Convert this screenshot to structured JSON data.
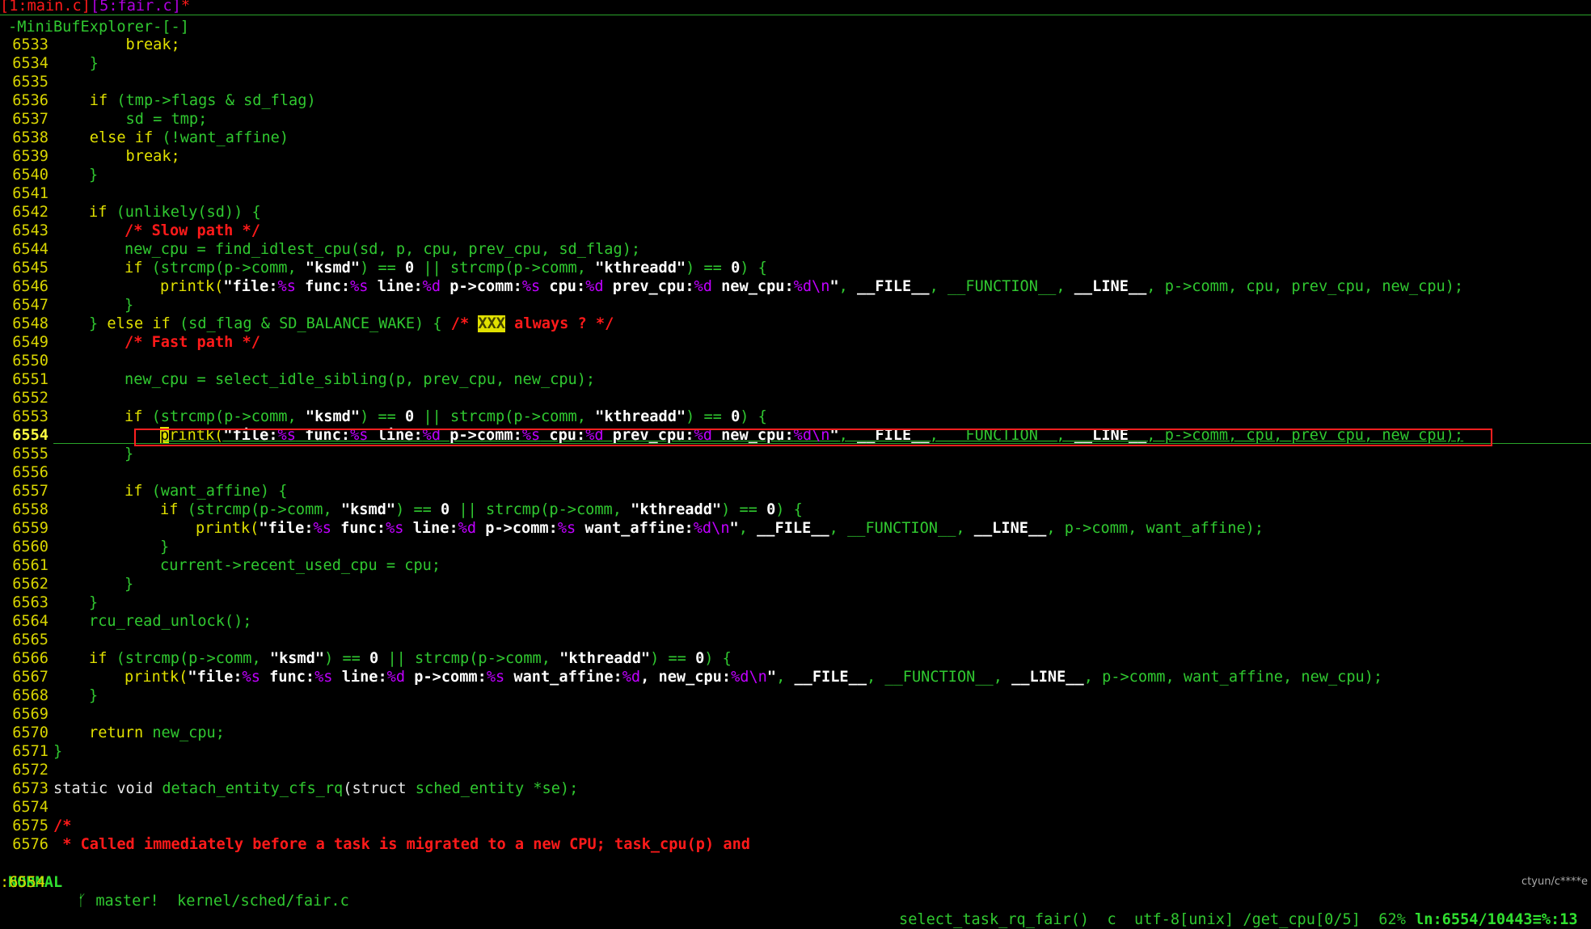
{
  "tabline": {
    "tab1": "[1:main.c]",
    "tab2": "[5:fair.c]",
    "modified": "*"
  },
  "minibuf": "-MiniBufExplorer-[-]",
  "gutter": [
    "6533",
    "6534",
    "6535",
    "6536",
    "6537",
    "6538",
    "6539",
    "6540",
    "6541",
    "6542",
    "6543",
    "6544",
    "6545",
    "6546",
    "6547",
    "6548",
    "6549",
    "6550",
    "6551",
    "6552",
    "6553",
    "6554",
    "6555",
    "6556",
    "6557",
    "6558",
    "6559",
    "6560",
    "6561",
    "6562",
    "6563",
    "6564",
    "6565",
    "6566",
    "6567",
    "6568",
    "6569",
    "6570",
    "6571",
    "6572",
    "6573",
    "6574",
    "6575",
    "6576"
  ],
  "code": {
    "l6533": "        break;",
    "l6534": "    }",
    "l6536a": "    ",
    "l6536b": "if",
    "l6536c": " (tmp->flags & sd_flag)",
    "l6537": "        sd = tmp;",
    "l6538a": "    ",
    "l6538b": "else if",
    "l6538c": " (!want_affine)",
    "l6539": "        break;",
    "l6540": "}",
    "l6542a": "if",
    "l6542b": " (unlikely(sd)) {",
    "l6543": "/* Slow path */",
    "l6544": "new_cpu = find_idlest_cpu(sd, p, cpu, prev_cpu, sd_flag);",
    "strcmp_if": "if",
    "strcmp_1": " (strcmp(p->comm, ",
    "ksmd": "\"ksmd\"",
    "strcmp_2": ") == ",
    "zero": "0",
    "strcmp_3": " || strcmp(p->comm, ",
    "kthreadd": "\"kthreadd\"",
    "strcmp_4": ") == ",
    "strcmp_5": ") {",
    "printk": "printk(",
    "pk_file": "\"file:",
    "fmt_s": "%s",
    "pk_func": " func:",
    "pk_line": " line:",
    "fmt_d": "%d",
    "pk_comm": " p->comm:",
    "pk_cpu": " cpu:",
    "pk_prev": " prev_cpu:",
    "pk_new": " new_cpu:",
    "fmt_dn": "%d\\n",
    "quote": "\"",
    "comma": ", ",
    "FILE": "__FILE__",
    "FUNCTION": "__FUNCTION__",
    "LINE": "__LINE__",
    "args1": "p->comm, cpu, prev_cpu, new_cpu);",
    "close": "}",
    "l6548a": "} ",
    "l6548b": "else if",
    "l6548c": " (sd_flag & SD_BALANCE_WAKE) { ",
    "l6548d": "/* ",
    "xxx": "XXX",
    "l6548e": " always ? */",
    "l6549": "/* Fast path */",
    "l6551": "new_cpu = select_idle_sibling(p, prev_cpu, new_cpu);",
    "l6554_p": "p",
    "l6554_rest": "rintk(",
    "l6557a": "if",
    "l6557b": " (want_affine) {",
    "pk_wa": " want_affine:",
    "args2": "p->comm, want_affine);",
    "l6561": "current->recent_used_cpu = cpu;",
    "l6564": "rcu_read_unlock();",
    "pk_wa2": " want_affine:",
    "pk_newcpu2": ", new_cpu:",
    "args3": "p->comm, want_affine, new_cpu);",
    "l6570a": "return",
    "l6570b": " new_cpu;",
    "l6573a": "static void ",
    "l6573b": "detach_entity_cfs_rq",
    "l6573c": "(",
    "l6573d": "struct",
    "l6573e": " sched_entity *se);",
    "l6575": "/*",
    "l6576": " * Called immediately before a task is migrated to a new CPU; task_cpu(p) and"
  },
  "status": {
    "mode": "NORMAL",
    "branch": "ᚶ master!  kernel/sched/fair.c",
    "right": "select_task_rq_fair()  c  utf-8[unix] /get_cpu[0/5]  62% ",
    "pos": "ln:6554/10443≡%:13  ≡"
  },
  "cmdline": ":6554",
  "watermark": "ctyun/c****e",
  "colors": {
    "keyword": "#e0e000",
    "code": "#30c830",
    "comment": "#ff1a1a",
    "format": "#c000ff",
    "linenr": "#d8d400"
  }
}
